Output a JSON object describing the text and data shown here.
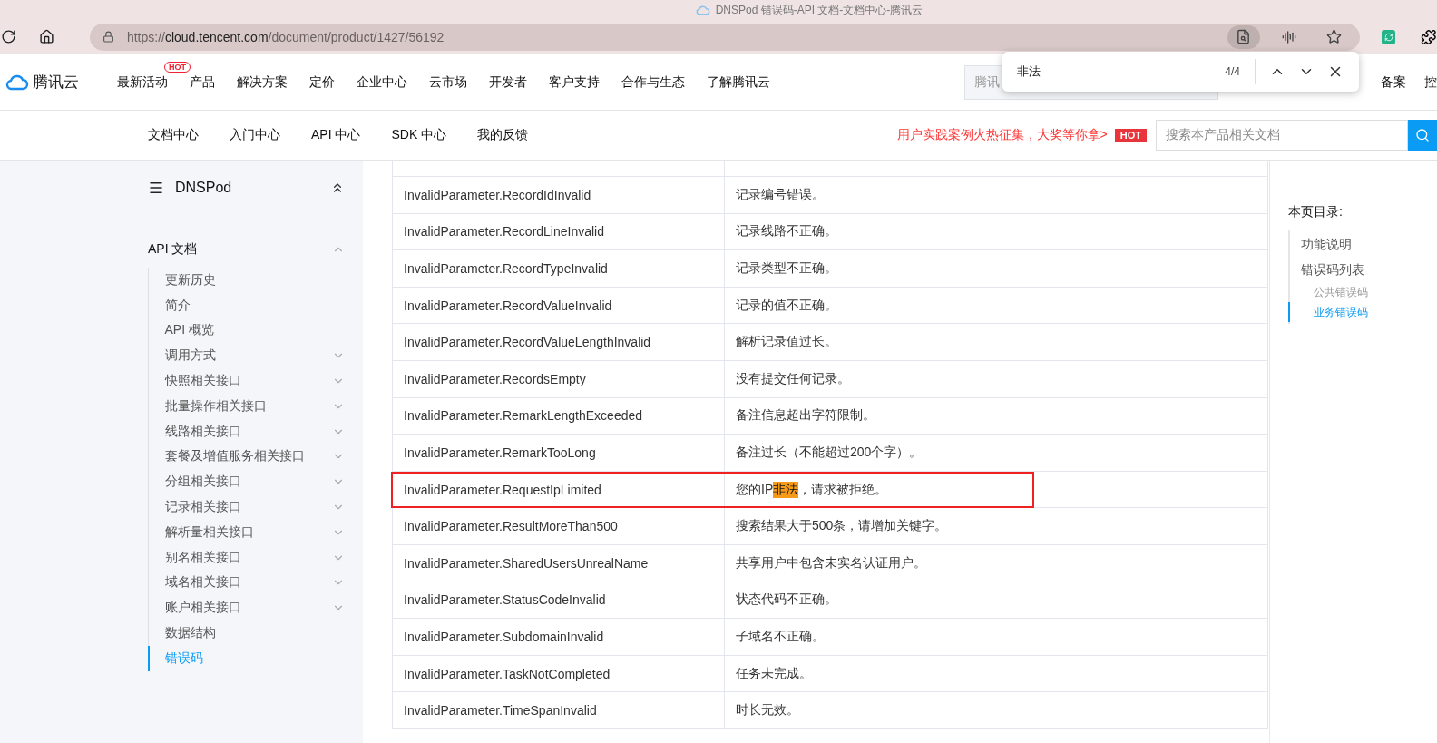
{
  "browser": {
    "title": "DNSPod 错误码-API 文档-文档中心-腾讯云",
    "url": {
      "scheme": "https://",
      "host": "cloud.tencent.com",
      "path": "/document/product/1427/56192"
    }
  },
  "find_bar": {
    "query": "非法",
    "count": "4/4"
  },
  "top_nav": {
    "logo_text": "腾讯云",
    "items": [
      {
        "label": "最新活动",
        "badge": "HOT"
      },
      {
        "label": "产品"
      },
      {
        "label": "解决方案"
      },
      {
        "label": "定价"
      },
      {
        "label": "企业中心"
      },
      {
        "label": "云市场"
      },
      {
        "label": "开发者"
      },
      {
        "label": "客户支持"
      },
      {
        "label": "合作与生态"
      },
      {
        "label": "了解腾讯云"
      }
    ],
    "search_placeholder": "腾讯",
    "right_items": [
      "备案",
      "控"
    ]
  },
  "sub_nav": {
    "items": [
      "文档中心",
      "入门中心",
      "API 中心",
      "SDK 中心",
      "我的反馈"
    ],
    "promo": "用户实践案例火热征集，大奖等你拿>",
    "promo_badge": "HOT",
    "search_placeholder": "搜索本产品相关文档"
  },
  "sidebar": {
    "title": "DNSPod",
    "section": {
      "label": "API 文档",
      "expanded": true
    },
    "items": [
      {
        "label": "更新历史",
        "expandable": false,
        "selected": false
      },
      {
        "label": "简介",
        "expandable": false,
        "selected": false
      },
      {
        "label": "API 概览",
        "expandable": false,
        "selected": false
      },
      {
        "label": "调用方式",
        "expandable": true,
        "selected": false
      },
      {
        "label": "快照相关接口",
        "expandable": true,
        "selected": false
      },
      {
        "label": "批量操作相关接口",
        "expandable": true,
        "selected": false
      },
      {
        "label": "线路相关接口",
        "expandable": true,
        "selected": false
      },
      {
        "label": "套餐及增值服务相关接口",
        "expandable": true,
        "selected": false
      },
      {
        "label": "分组相关接口",
        "expandable": true,
        "selected": false
      },
      {
        "label": "记录相关接口",
        "expandable": true,
        "selected": false
      },
      {
        "label": "解析量相关接口",
        "expandable": true,
        "selected": false
      },
      {
        "label": "别名相关接口",
        "expandable": true,
        "selected": false
      },
      {
        "label": "域名相关接口",
        "expandable": true,
        "selected": false
      },
      {
        "label": "账户相关接口",
        "expandable": true,
        "selected": false
      },
      {
        "label": "数据结构",
        "expandable": false,
        "selected": false
      },
      {
        "label": "错误码",
        "expandable": false,
        "selected": true
      }
    ]
  },
  "table": {
    "rows": [
      {
        "code": "InvalidParameter.RecordIdInvalid",
        "description": [
          "记录编号错误。"
        ],
        "outlined": false
      },
      {
        "code": "InvalidParameter.RecordLineInvalid",
        "description": [
          "记录线路不正确。"
        ],
        "outlined": false
      },
      {
        "code": "InvalidParameter.RecordTypeInvalid",
        "description": [
          "记录类型不正确。"
        ],
        "outlined": false
      },
      {
        "code": "InvalidParameter.RecordValueInvalid",
        "description": [
          "记录的值不正确。"
        ],
        "outlined": false
      },
      {
        "code": "InvalidParameter.RecordValueLengthInvalid",
        "description": [
          "解析记录值过长。"
        ],
        "outlined": false
      },
      {
        "code": "InvalidParameter.RecordsEmpty",
        "description": [
          "没有提交任何记录。"
        ],
        "outlined": false
      },
      {
        "code": "InvalidParameter.RemarkLengthExceeded",
        "description": [
          "备注信息超出字符限制。"
        ],
        "outlined": false
      },
      {
        "code": "InvalidParameter.RemarkTooLong",
        "description": [
          "备注过长（不能超过200个字）。"
        ],
        "outlined": false
      },
      {
        "code": "InvalidParameter.RequestIpLimited",
        "description": [
          "您的IP",
          "非法",
          "，请求被拒绝。"
        ],
        "outlined": true
      },
      {
        "code": "InvalidParameter.ResultMoreThan500",
        "description": [
          "搜索结果大于500条，请增加关键字。"
        ],
        "outlined": false
      },
      {
        "code": "InvalidParameter.SharedUsersUnrealName",
        "description": [
          "共享用户中包含未实名认证用户。"
        ],
        "outlined": false
      },
      {
        "code": "InvalidParameter.StatusCodeInvalid",
        "description": [
          "状态代码不正确。"
        ],
        "outlined": false
      },
      {
        "code": "InvalidParameter.SubdomainInvalid",
        "description": [
          "子域名不正确。"
        ],
        "outlined": false
      },
      {
        "code": "InvalidParameter.TaskNotCompleted",
        "description": [
          "任务未完成。"
        ],
        "outlined": false
      },
      {
        "code": "InvalidParameter.TimeSpanInvalid",
        "description": [
          "时长无效。"
        ],
        "outlined": false
      }
    ]
  },
  "toc": {
    "title": "本页目录:",
    "items": [
      {
        "label": "功能说明",
        "selected": false
      },
      {
        "label": "错误码列表",
        "selected": false,
        "children": [
          {
            "label": "公共错误码",
            "selected": false
          },
          {
            "label": "业务错误码",
            "selected": true
          }
        ]
      }
    ]
  }
}
